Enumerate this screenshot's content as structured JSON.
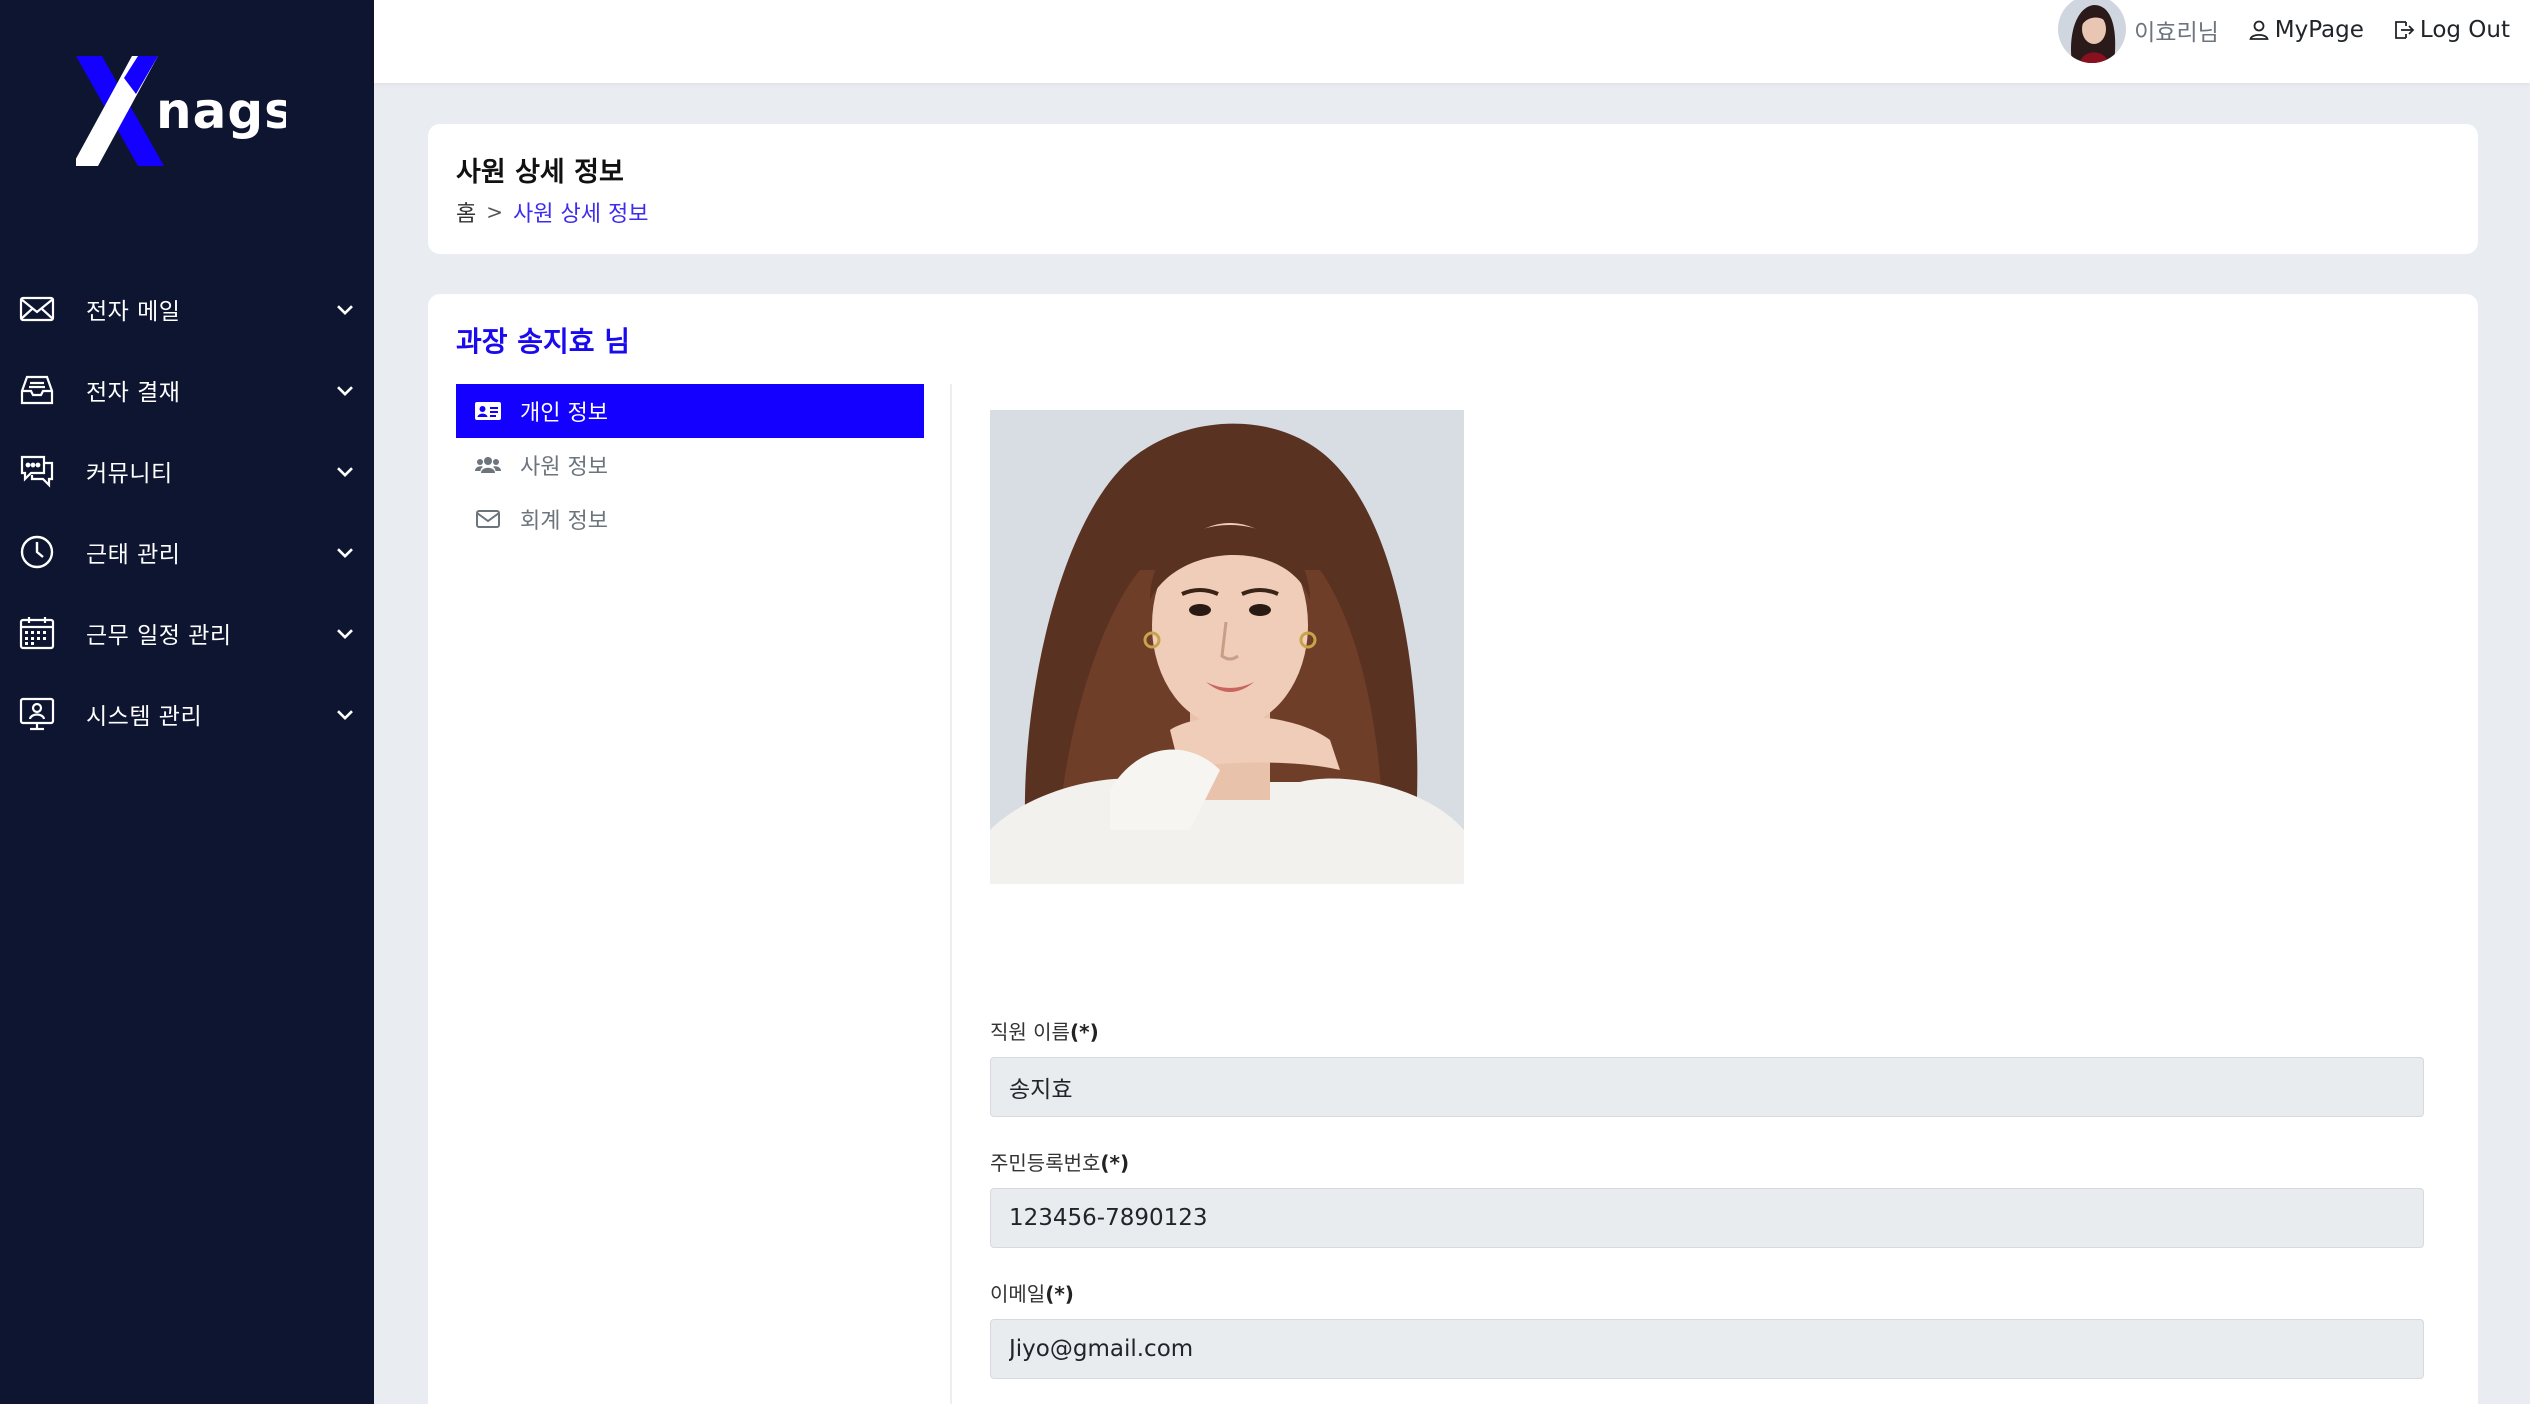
{
  "brand": {
    "logo_text": "Xnags",
    "accent": "#1400ff",
    "sidebar_bg": "#0e1530"
  },
  "sidebar": {
    "items": [
      {
        "label": "전자 메일",
        "icon": "mail-icon"
      },
      {
        "label": "전자 결재",
        "icon": "inbox-tray-icon"
      },
      {
        "label": "커뮤니티",
        "icon": "chat-bubbles-icon"
      },
      {
        "label": "근태 관리",
        "icon": "clock-icon"
      },
      {
        "label": "근무 일정 관리",
        "icon": "calendar-icon"
      },
      {
        "label": "시스템 관리",
        "icon": "monitor-user-icon"
      }
    ]
  },
  "topbar": {
    "user_name": "이효리님",
    "mypage_label": "MyPage",
    "logout_label": "Log Out"
  },
  "page": {
    "title": "사원 상세 정보",
    "breadcrumb_home": "홈",
    "breadcrumb_sep": ">",
    "breadcrumb_current": "사원 상세 정보"
  },
  "employee": {
    "heading": "과장 송지효 님",
    "tabs": [
      {
        "label": "개인 정보",
        "icon": "id-card-icon",
        "active": true
      },
      {
        "label": "사원 정보",
        "icon": "users-icon",
        "active": false
      },
      {
        "label": "회계 정보",
        "icon": "envelope-icon",
        "active": false
      }
    ],
    "fields": {
      "name": {
        "label": "직원 이름",
        "required": "(*)",
        "value": "송지효"
      },
      "rrn": {
        "label": "주민등록번호",
        "required": "(*)",
        "value": "123456-7890123"
      },
      "email": {
        "label": "이메일",
        "required": "(*)",
        "value": "Jiyo@gmail.com"
      }
    }
  }
}
